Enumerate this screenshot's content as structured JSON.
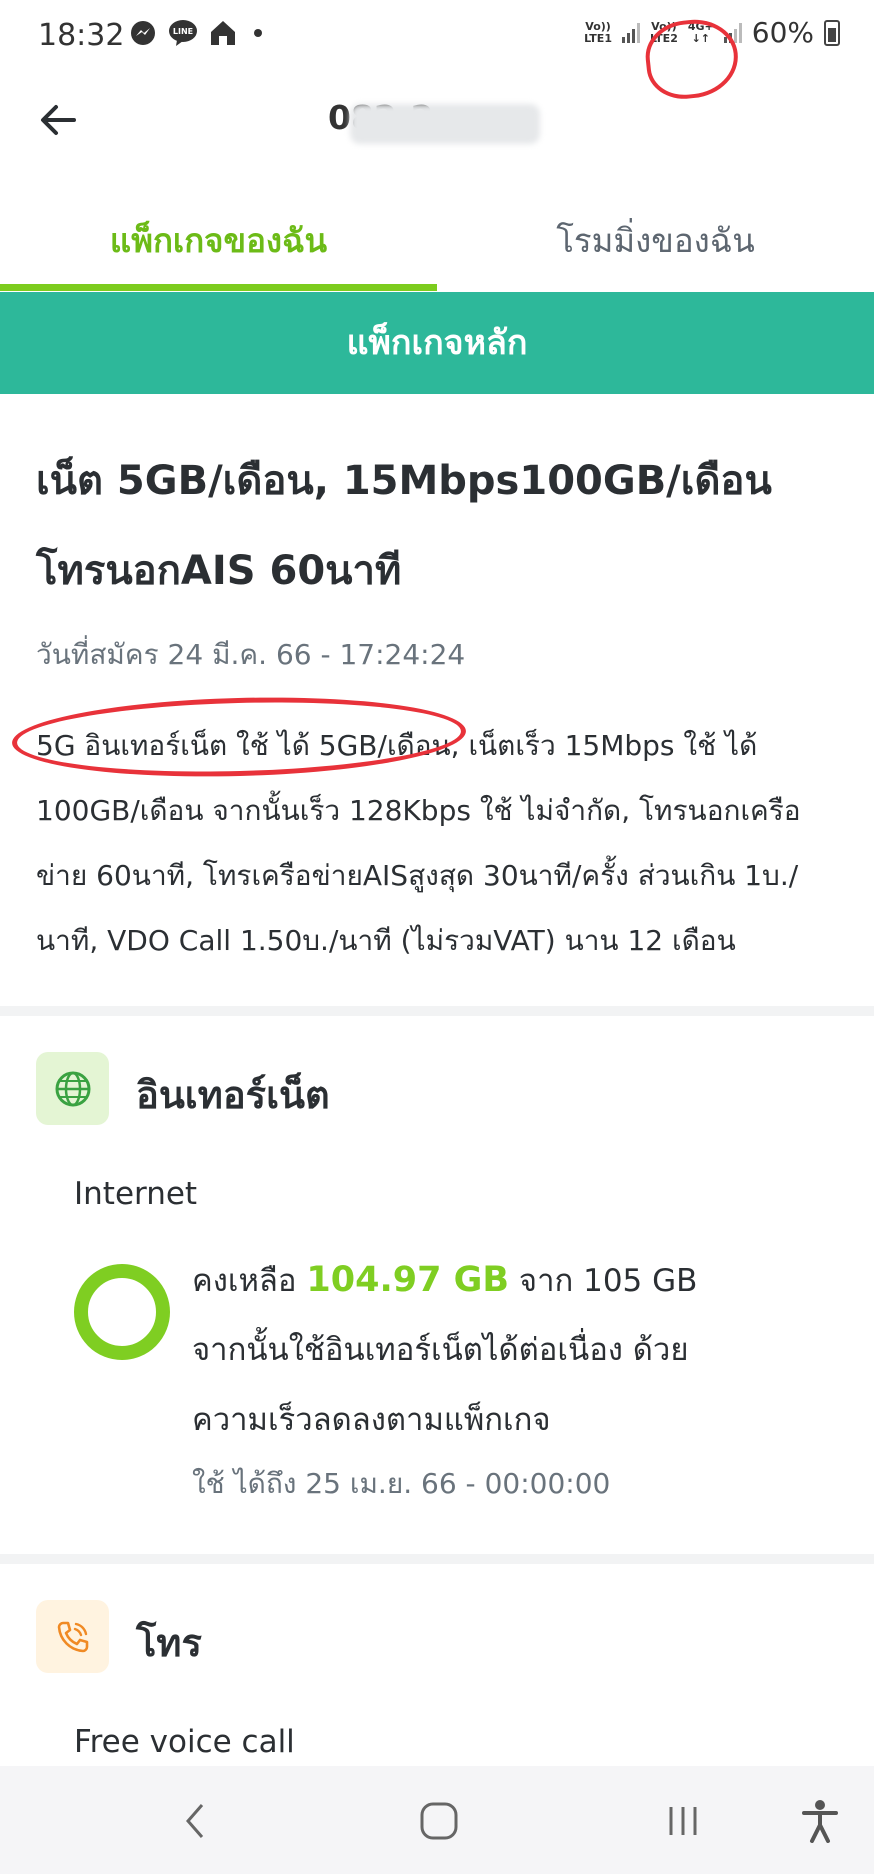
{
  "status_bar": {
    "time": "18:32",
    "sim1_tag_top": "Vo))",
    "sim1_tag_bottom": "LTE1",
    "sim2_tag_top": "Vo))",
    "sim2_tag_bottom": "LTE2",
    "network_tag_top": "4G+",
    "network_tag_bottom": "↓↑",
    "battery": "60%"
  },
  "header": {
    "phone_number_visible": "082-2"
  },
  "tabs": [
    {
      "label": "แพ็กเกจของฉัน",
      "active": true
    },
    {
      "label": "โรมมิ่งของฉัน",
      "active": false
    }
  ],
  "banner": {
    "label": "แพ็กเกจหลัก"
  },
  "package": {
    "title": "เน็ต 5GB/เดือน, 15Mbps100GB/เดือน โทรนอกAIS 60นาที",
    "subscribe_date": "วันที่สมัคร 24 มี.ค. 66 - 17:24:24",
    "description": "5G อินเทอร์เน็ต ใช้ ได้ 5GB/เดือน, เน็ตเร็ว 15Mbps ใช้ ได้ 100GB/เดือน จากนั้นเร็ว 128Kbps ใช้ ไม่จำกัด, โทรนอกเครือข่าย 60นาที, โทรเครือข่ายAISสูงสุด 30นาที/ครั้ง ส่วนเกิน 1บ./นาที, VDO Call 1.50บ./นาที (ไม่รวมVAT) นาน 12 เดือน"
  },
  "internet_section": {
    "title": "อินเทอร์เน็ต",
    "icon": "globe-icon",
    "sub_label": "Internet",
    "remaining_prefix": "คงเหลือ",
    "remaining_value": "104.97 GB",
    "remaining_suffix": "จาก 105 GB",
    "remaining_fraction": 0.9997,
    "note_line1": "จากนั้นใช้อินเทอร์เน็ตได้ต่อเนื่อง ด้วย",
    "note_line2": "ความเร็วลดลงตามแพ็กเกจ",
    "valid_until": "ใช้ ได้ถึง 25 เม.ย. 66 - 00:00:00"
  },
  "call_section": {
    "title": "โทร",
    "icon": "phone-icon",
    "sub_label": "Free voice call"
  },
  "colors": {
    "accent_green": "#7fce22",
    "banner_teal": "#2db89a",
    "annotation_red": "#e8323a"
  }
}
